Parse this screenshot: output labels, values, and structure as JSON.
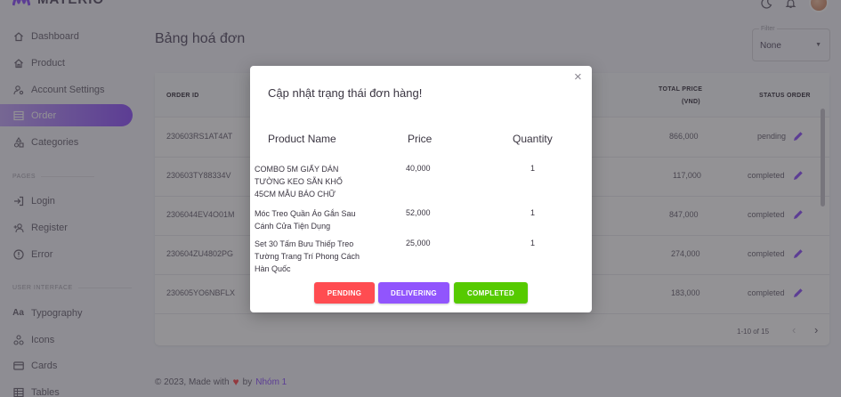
{
  "brand": {
    "name": "MATERIO"
  },
  "colors": {
    "accent": "#9155fd",
    "pending": "#ff4c51",
    "delivering": "#9155fd",
    "completed": "#56ca00",
    "edit_icon": "#9155fd"
  },
  "sidebar": {
    "items": [
      {
        "label": "Dashboard",
        "icon": "home-outline-icon"
      },
      {
        "label": "Product",
        "icon": "home-icon"
      },
      {
        "label": "Account Settings",
        "icon": "account-cog-icon"
      },
      {
        "label": "Order",
        "icon": "table-icon",
        "active": true
      },
      {
        "label": "Categories",
        "icon": "shapes-icon"
      }
    ],
    "pages_label": "PAGES",
    "pages": [
      {
        "label": "Login",
        "icon": "login-icon"
      },
      {
        "label": "Register",
        "icon": "account-plus-icon"
      },
      {
        "label": "Error",
        "icon": "alert-circle-icon"
      }
    ],
    "ui_label": "USER INTERFACE",
    "ui": [
      {
        "label": "Typography",
        "icon": "format-letter-case-icon"
      },
      {
        "label": "Icons",
        "icon": "google-circles-icon"
      },
      {
        "label": "Cards",
        "icon": "credit-card-icon"
      },
      {
        "label": "Tables",
        "icon": "table-large-icon"
      }
    ]
  },
  "page": {
    "title": "Bảng hoá đơn"
  },
  "filter": {
    "label": "Filter",
    "value": "None"
  },
  "table": {
    "headers": {
      "order_id": "ORDER ID",
      "total_price_line1": "TOTAL PRICE",
      "total_price_line2": "(VND)",
      "status": "STATUS ORDER"
    },
    "rows": [
      {
        "id": "230603RS1AT4AT",
        "price": "866,000",
        "status": "pending"
      },
      {
        "id": "230603TY88334V",
        "price": "117,000",
        "status": "completed"
      },
      {
        "id": "2306044EV4O01M",
        "price": "847,000",
        "status": "completed"
      },
      {
        "id": "230604ZU4802PG",
        "price": "274,000",
        "status": "completed"
      },
      {
        "id": "230605YO6NBFLX",
        "price": "183,000",
        "status": "completed"
      }
    ],
    "pagination": "1-10 of 15"
  },
  "footer": {
    "text": "© 2023, Made with",
    "by": "by",
    "author": "Nhóm 1"
  },
  "modal": {
    "title": "Cập nhật trạng thái đơn hàng!",
    "headers": {
      "name": "Product Name",
      "price": "Price",
      "quantity": "Quantity"
    },
    "items": [
      {
        "name": "COMBO 5M GIẤY DÁN TƯỜNG KEO SẴN KHỔ 45CM MẪU BÁO CHỮ",
        "price": "40,000",
        "quantity": "1"
      },
      {
        "name": "Móc Treo Quần Áo Gắn Sau Cánh Cửa Tiện Dụng",
        "price": "52,000",
        "quantity": "1"
      },
      {
        "name": "Set 30 Tấm Bưu Thiếp Treo Tường Trang Trí Phong Cách Hàn Quốc",
        "price": "25,000",
        "quantity": "1"
      }
    ],
    "buttons": {
      "pending": "PENDING",
      "delivering": "DELIVERING",
      "completed": "COMPLETED"
    },
    "close": "×"
  }
}
